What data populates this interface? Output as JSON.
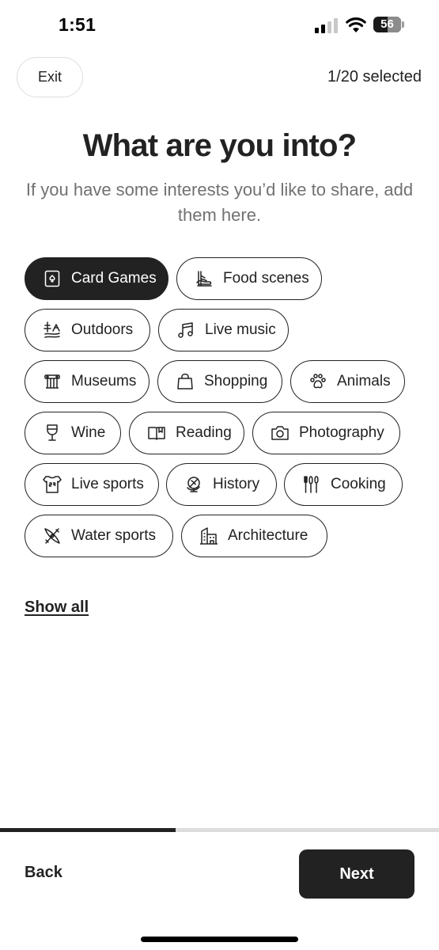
{
  "status_bar": {
    "time": "1:51",
    "battery": "56"
  },
  "header": {
    "exit_label": "Exit",
    "selected_count": "1/20 selected"
  },
  "title": "What are you into?",
  "subtitle": "If you have some interests you’d like to share, add them here.",
  "interests": [
    {
      "label": "Card Games",
      "icon": "card-games-icon",
      "selected": true
    },
    {
      "label": "Food scenes",
      "icon": "food-scenes-icon",
      "selected": false
    },
    {
      "label": "Outdoors",
      "icon": "outdoors-icon",
      "selected": false
    },
    {
      "label": "Live music",
      "icon": "music-note-icon",
      "selected": false
    },
    {
      "label": "Museums",
      "icon": "museum-icon",
      "selected": false
    },
    {
      "label": "Shopping",
      "icon": "shopping-bag-icon",
      "selected": false
    },
    {
      "label": "Animals",
      "icon": "paw-icon",
      "selected": false
    },
    {
      "label": "Wine",
      "icon": "wine-glass-icon",
      "selected": false
    },
    {
      "label": "Reading",
      "icon": "book-icon",
      "selected": false
    },
    {
      "label": "Photography",
      "icon": "camera-icon",
      "selected": false
    },
    {
      "label": "Live sports",
      "icon": "jersey-icon",
      "selected": false
    },
    {
      "label": "History",
      "icon": "globe-icon",
      "selected": false
    },
    {
      "label": "Cooking",
      "icon": "utensils-icon",
      "selected": false
    },
    {
      "label": "Water sports",
      "icon": "kayak-icon",
      "selected": false
    },
    {
      "label": "Architecture",
      "icon": "building-icon",
      "selected": false
    }
  ],
  "show_all_label": "Show all",
  "footer": {
    "back_label": "Back",
    "next_label": "Next",
    "progress": 0.4
  },
  "colors": {
    "text": "#222222",
    "muted": "#717171",
    "selected_bg": "#222222",
    "border_light": "#dddddd"
  }
}
